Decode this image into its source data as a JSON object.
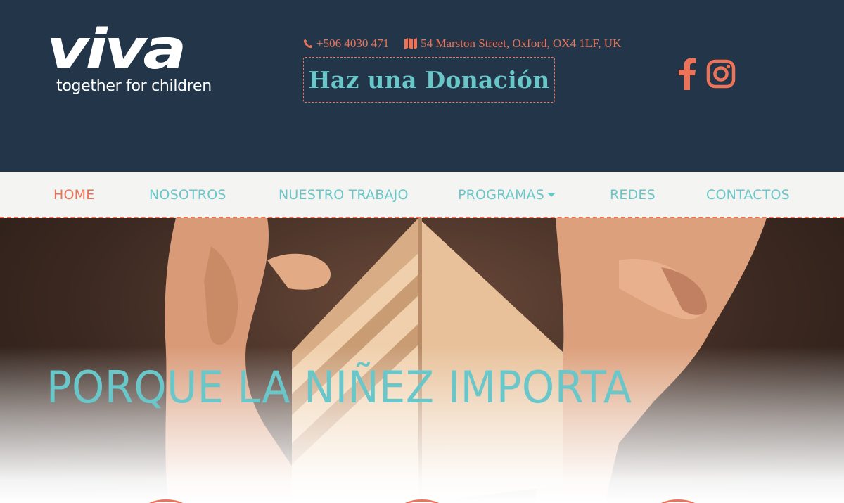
{
  "brand": {
    "wordmark": "viva",
    "tagline": "together for children"
  },
  "contact": {
    "phone": "+506 4030 471",
    "address": "54 Marston Street, Oxford, OX4 1LF, UK",
    "phone_icon": "phone-icon",
    "address_icon": "map-icon"
  },
  "donate": {
    "label": "Haz una Donación"
  },
  "social": {
    "facebook_icon": "facebook-icon",
    "instagram_icon": "instagram-icon"
  },
  "nav": {
    "items": [
      {
        "label": "HOME",
        "active": true
      },
      {
        "label": "NOSOTROS",
        "active": false
      },
      {
        "label": "NUESTRO TRABAJO",
        "active": false
      },
      {
        "label": "PROGRAMAS",
        "active": false,
        "has_dropdown": true
      },
      {
        "label": "REDES",
        "active": false
      },
      {
        "label": "CONTACTOS",
        "active": false
      }
    ]
  },
  "hero": {
    "title": "PORQUE LA NIÑEZ IMPORTA"
  },
  "colors": {
    "header_bg": "#233649",
    "accent": "#ec7357",
    "teal": "#6ac7c9",
    "nav_bg": "#f4f4f2"
  }
}
